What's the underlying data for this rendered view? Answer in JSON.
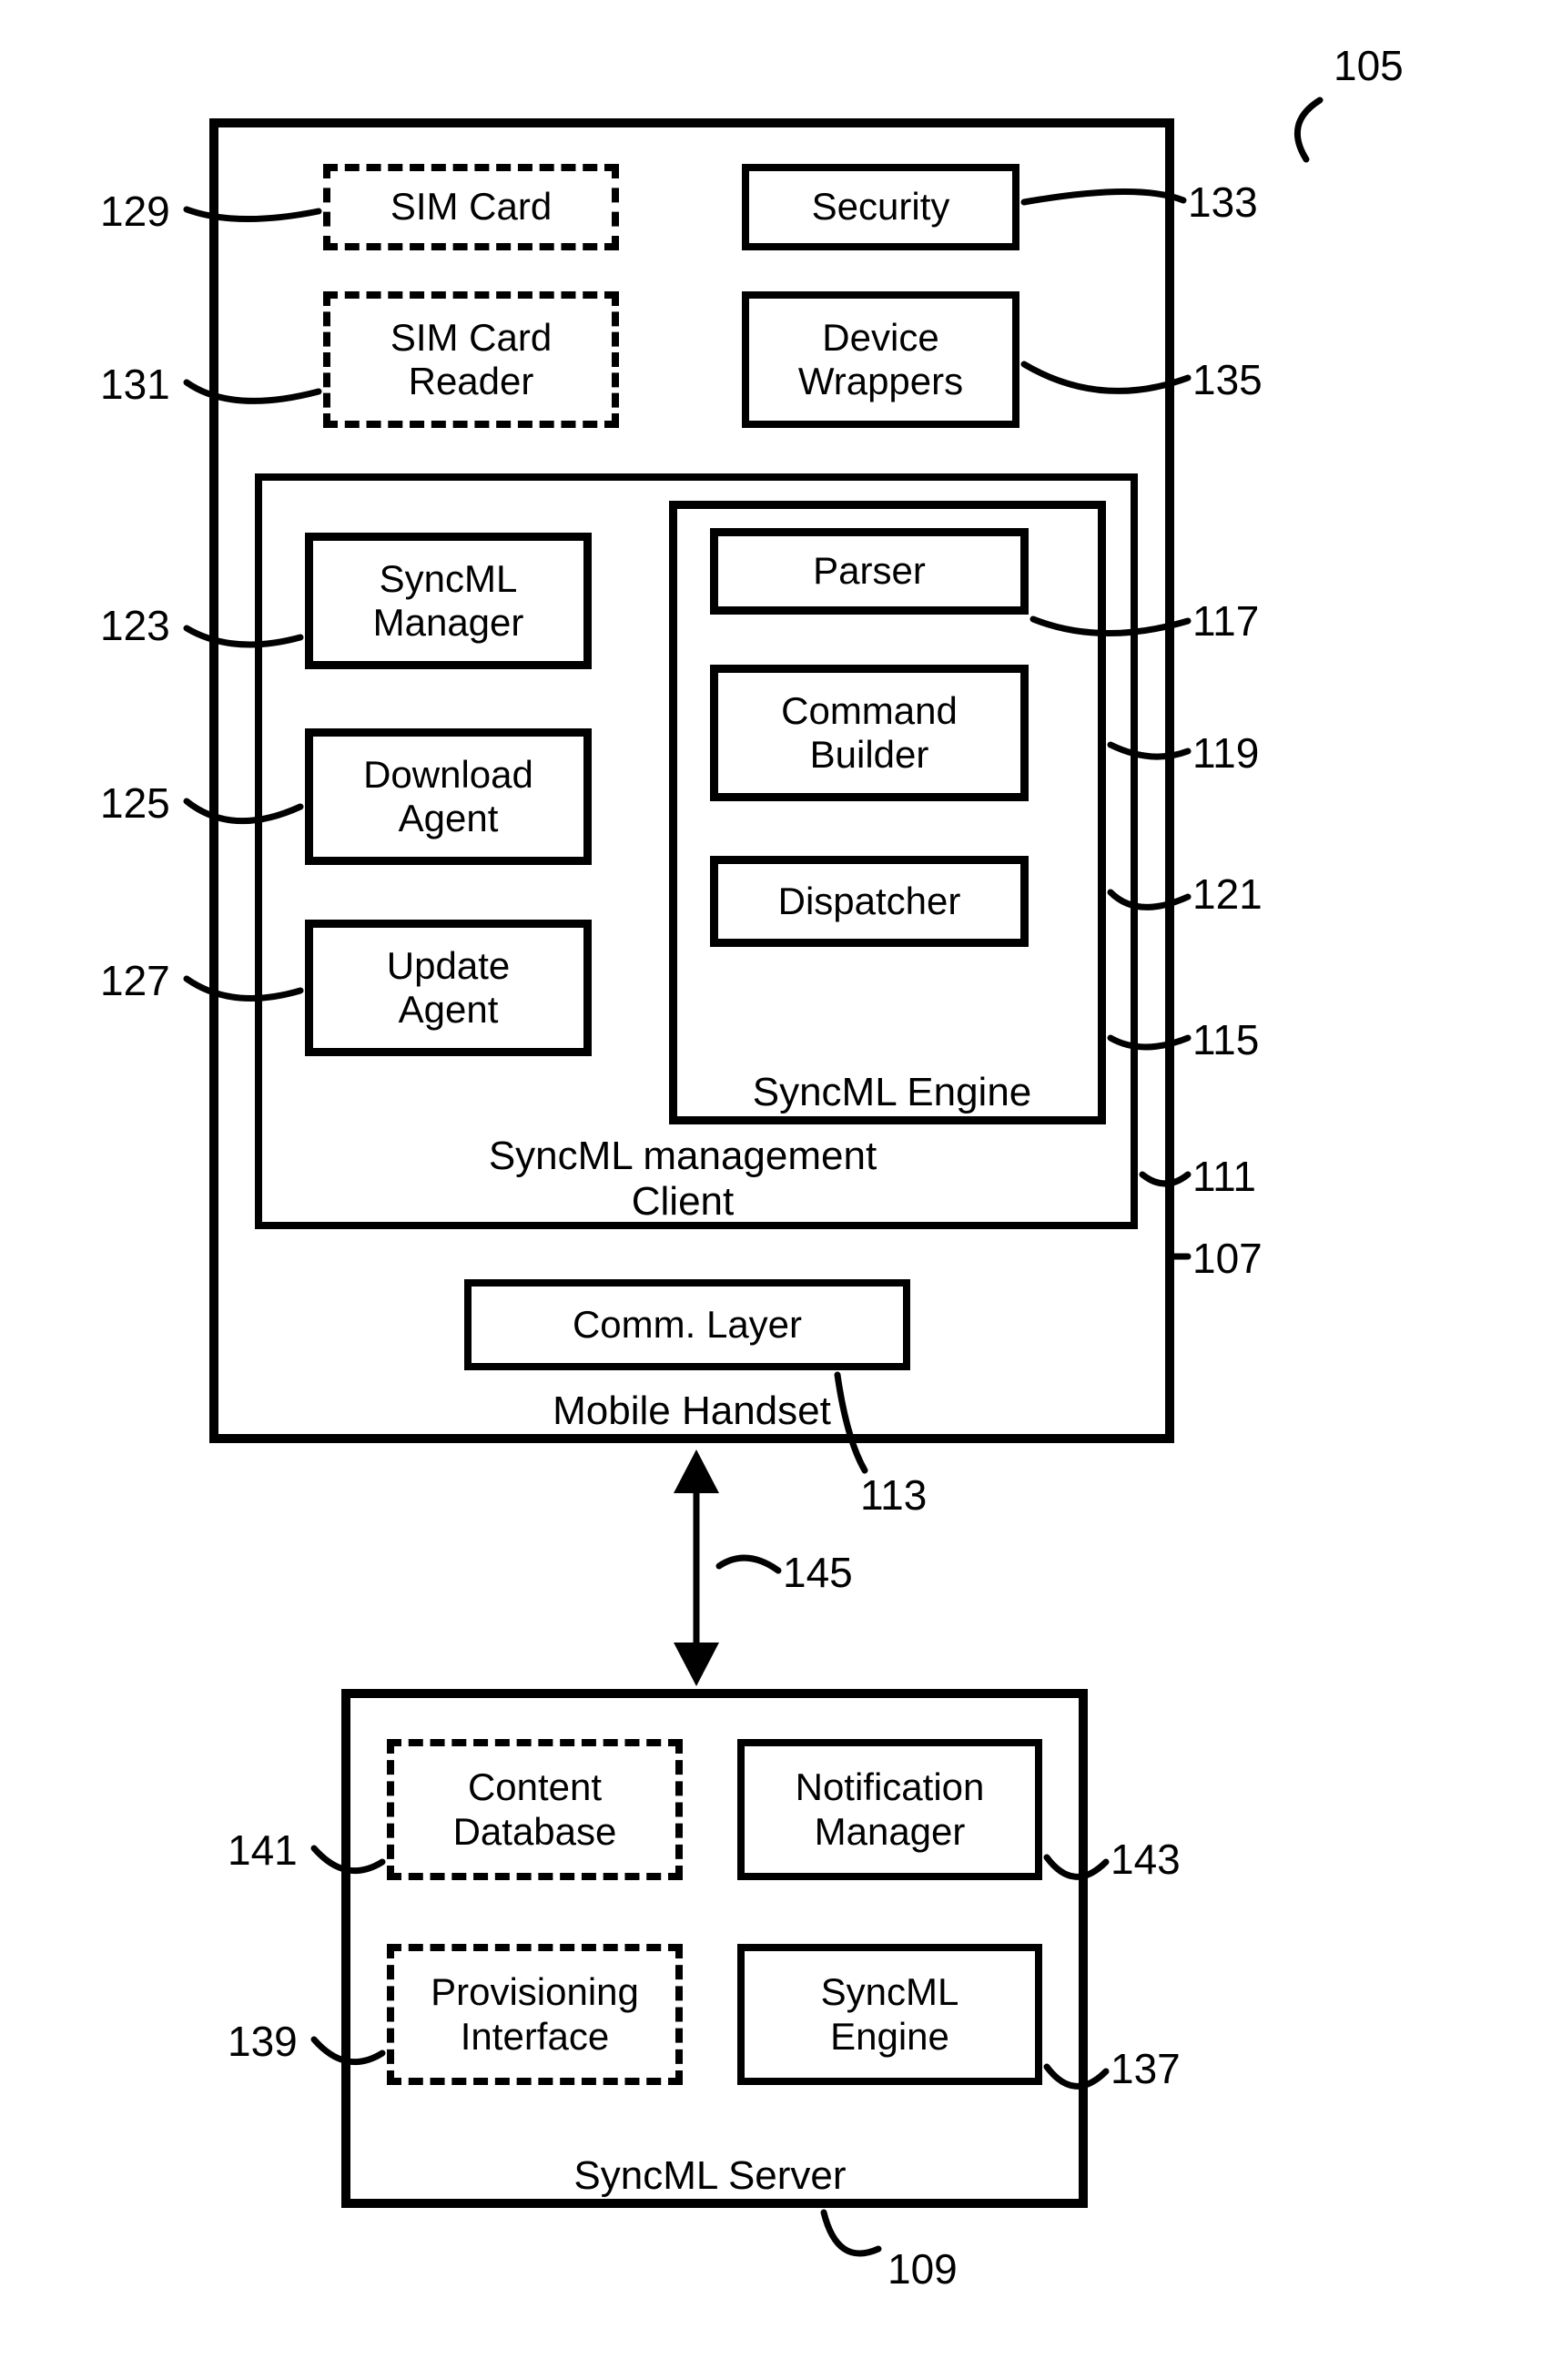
{
  "diagram_ref": "105",
  "handset": {
    "title": "Mobile Handset",
    "ref": "107",
    "sim_card": {
      "label": "SIM Card",
      "ref": "129"
    },
    "sim_card_reader": {
      "label": "SIM Card\nReader",
      "ref": "131"
    },
    "security": {
      "label": "Security",
      "ref": "133"
    },
    "device_wrappers": {
      "label": "Device\nWrappers",
      "ref": "135"
    },
    "client": {
      "title": "SyncML management\nClient",
      "ref": "111",
      "syncml_manager": {
        "label": "SyncML\nManager",
        "ref": "123"
      },
      "download_agent": {
        "label": "Download\nAgent",
        "ref": "125"
      },
      "update_agent": {
        "label": "Update\nAgent",
        "ref": "127"
      },
      "engine": {
        "title": "SyncML Engine",
        "ref": "115",
        "parser": {
          "label": "Parser",
          "ref": "117"
        },
        "command_builder": {
          "label": "Command\nBuilder",
          "ref": "119"
        },
        "dispatcher": {
          "label": "Dispatcher",
          "ref": "121"
        }
      }
    },
    "comm_layer": {
      "label": "Comm. Layer",
      "ref": "113"
    }
  },
  "link_ref": "145",
  "server": {
    "title": "SyncML Server",
    "ref": "109",
    "content_db": {
      "label": "Content\nDatabase",
      "ref": "141"
    },
    "notification_mgr": {
      "label": "Notification\nManager",
      "ref": "143"
    },
    "provisioning": {
      "label": "Provisioning\nInterface",
      "ref": "139"
    },
    "engine": {
      "label": "SyncML\nEngine",
      "ref": "137"
    }
  }
}
